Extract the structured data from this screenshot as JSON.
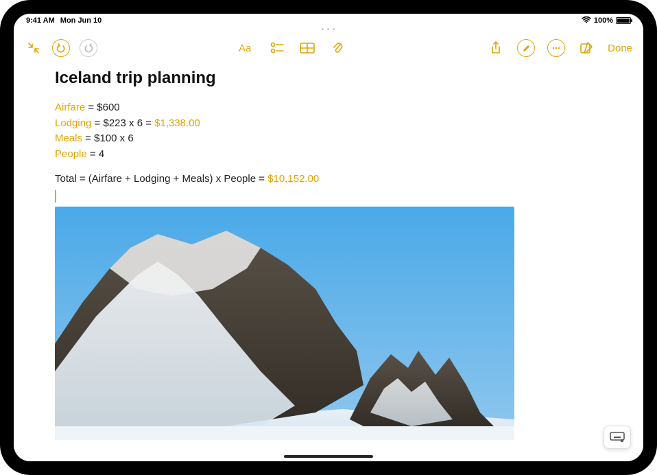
{
  "status": {
    "time": "9:41 AM",
    "date": "Mon Jun 10",
    "battery_pct": "100%"
  },
  "toolbar": {
    "done_label": "Done"
  },
  "note": {
    "title": "Iceland trip planning",
    "lines": {
      "airfare_var": "Airfare",
      "airfare_rest": " = $600",
      "lodging_var": "Lodging",
      "lodging_rest": " = $223 x 6  = ",
      "lodging_result": "$1,338.00",
      "meals_var": "Meals",
      "meals_rest": " = $100 x 6",
      "people_var": "People",
      "people_rest": " = 4",
      "total_label": "Total = (Airfare + Lodging + Meals)  x People  = ",
      "total_result": "$10,152.00"
    }
  },
  "colors": {
    "accent": "#E1A400"
  }
}
